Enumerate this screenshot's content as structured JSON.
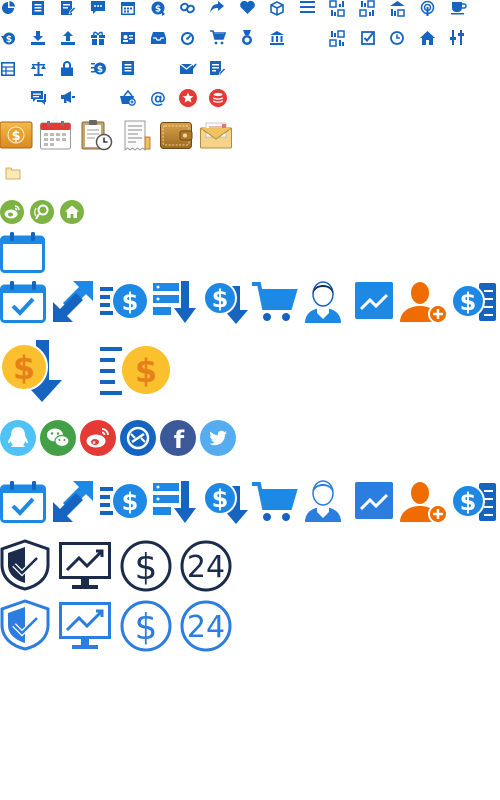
{
  "sprite_sheet": {
    "colors": {
      "primary_blue": "#1565c0",
      "mid_blue": "#1e88e5",
      "light_blue": "#2b7de0",
      "navy": "#1a2b4c",
      "dark_navy": "#0d2f5e",
      "orange": "#ef6c00",
      "gold": "#fbc02d",
      "weibo_green": "#7cb342",
      "qq_blue": "#4fc3f7",
      "wechat_green": "#43a047",
      "weibo_red": "#e53935",
      "facebook_blue": "#3b5998",
      "twitter_blue": "#55acee"
    },
    "rows": [
      {
        "name": "small-icons-row-1",
        "icons": [
          "pie-chart-icon",
          "document-icon",
          "edit-document-icon",
          "chat-icon",
          "calendar-icon",
          "money-transfer-icon",
          "link-icon",
          "share-icon",
          "heart-icon",
          "box-icon",
          "list-icon",
          "stats-icon",
          "stats-alt-icon",
          "stats-alt2-icon",
          "signal-icon",
          "coffee-icon"
        ]
      },
      {
        "name": "small-icons-row-2",
        "icons": [
          "money-cycle-icon",
          "download-icon",
          "upload-icon",
          "gift-icon",
          "id-card-icon",
          "inbox-icon",
          "speedometer-icon",
          "cart-icon",
          "medal-icon",
          "bank-icon",
          "grid-stats-icon",
          "checkbox-icon",
          "clock-icon",
          "home-icon",
          "equalizer-icon"
        ]
      },
      {
        "name": "small-icons-row-3",
        "icons": [
          "table-icon",
          "balance-scale-icon",
          "lock-icon",
          "money-list-icon",
          "document-alt-icon",
          "email-check-icon",
          "edit-list-icon"
        ]
      },
      {
        "name": "small-icons-row-4",
        "icons": [
          "comments-icon",
          "megaphone-icon",
          "shopping-basket-icon",
          "at-icon",
          "star-badge-icon",
          "coins-stack-icon"
        ]
      },
      {
        "name": "colorful-icons",
        "icons": [
          "dollar-box-icon",
          "calendar-color-icon",
          "clipboard-clock-icon",
          "receipt-icon",
          "wallet-icon",
          "envelope-icon"
        ]
      },
      {
        "name": "tiny-folder",
        "icons": [
          "folder-icon"
        ]
      },
      {
        "name": "green-circles",
        "icons": [
          "weibo-green-icon",
          "tencent-weibo-icon",
          "home-green-icon"
        ]
      },
      {
        "name": "big-calendar",
        "icons": [
          "calendar-empty-icon"
        ]
      },
      {
        "name": "blue-icons-row-1",
        "icons": [
          "calendar-check-icon",
          "transfer-arrows-icon",
          "money-list-icon",
          "server-download-icon",
          "money-down-icon",
          "shopping-cart-icon",
          "user-avatar-icon",
          "trend-chart-icon",
          "add-user-icon",
          "money-stack-icon"
        ]
      },
      {
        "name": "gold-icons",
        "icons": [
          "gold-money-down-icon",
          "gold-money-list-icon"
        ]
      },
      {
        "name": "social-icons",
        "icons": [
          "qq-icon",
          "wechat-icon",
          "weibo-icon",
          "tencent-icon",
          "facebook-icon",
          "twitter-icon"
        ]
      },
      {
        "name": "blue-icons-row-2",
        "icons": [
          "calendar-check-icon",
          "transfer-arrows-icon",
          "money-list-icon",
          "server-download-icon",
          "money-down-icon",
          "shopping-cart-icon",
          "user-avatar-icon",
          "trend-chart-icon",
          "add-user-icon",
          "money-stack-icon"
        ]
      },
      {
        "name": "outline-navy",
        "icons": [
          "shield-check-icon",
          "monitor-chart-icon",
          "dollar-circle-icon",
          "24-hours-icon"
        ]
      },
      {
        "name": "outline-blue",
        "icons": [
          "shield-check-icon",
          "monitor-chart-icon",
          "dollar-circle-icon",
          "24-hours-icon"
        ]
      }
    ],
    "labels": {
      "hours_24": "24",
      "dollar_sign": "$",
      "at_sign": "@",
      "facebook_letter": "f"
    }
  }
}
